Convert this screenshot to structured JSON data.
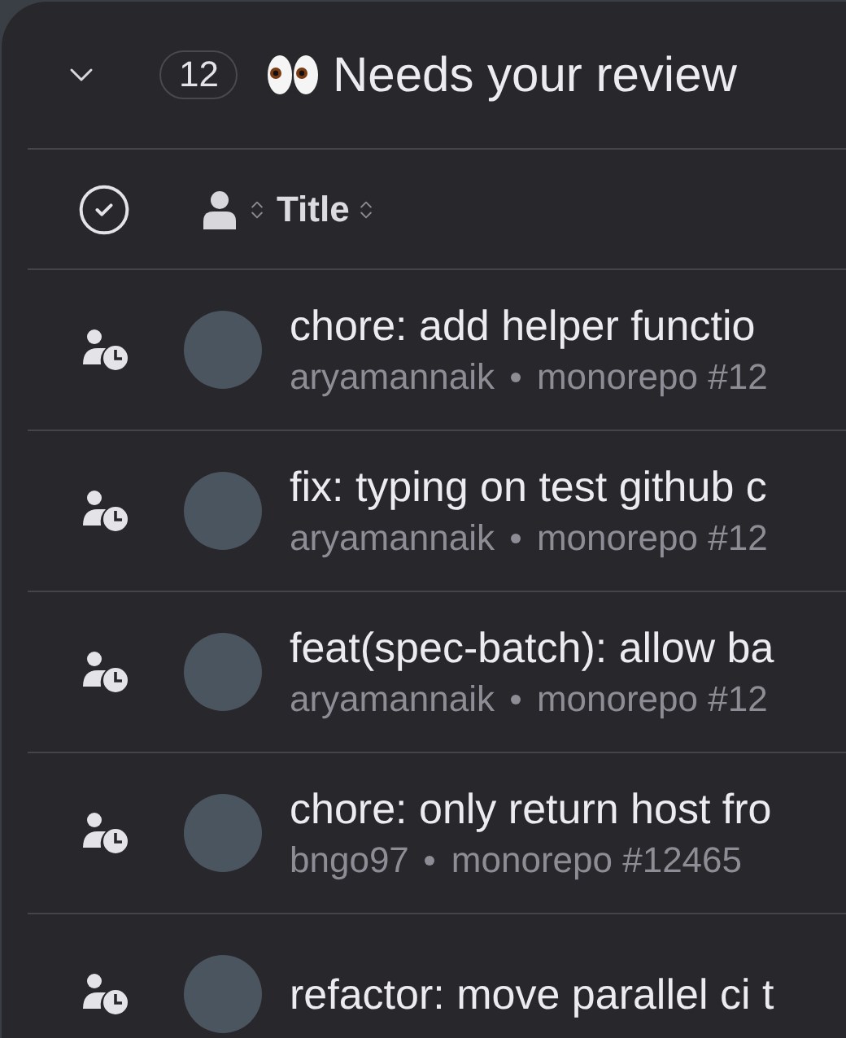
{
  "section": {
    "expanded": true,
    "count": "12",
    "title": "Needs your review"
  },
  "columns": [
    {
      "label": "Title"
    }
  ],
  "rows": [
    {
      "title": "chore: add helper functio",
      "author": "aryamannaik",
      "repo": "monorepo #12"
    },
    {
      "title": "fix: typing on test github c",
      "author": "aryamannaik",
      "repo": "monorepo #12"
    },
    {
      "title": "feat(spec-batch): allow ba",
      "author": "aryamannaik",
      "repo": "monorepo #12"
    },
    {
      "title": "chore: only return host fro",
      "author": "bngo97",
      "repo": "monorepo #12465"
    },
    {
      "title": "refactor: move parallel ci t"
    }
  ]
}
